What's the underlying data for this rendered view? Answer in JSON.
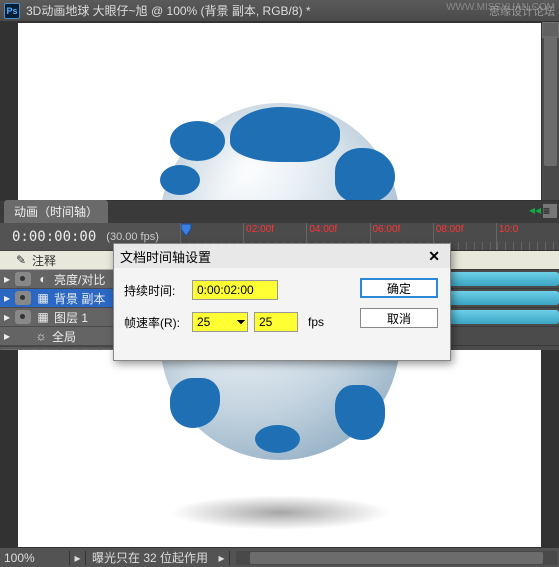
{
  "titlebar": {
    "app_icon_text": "Ps",
    "document_title": "3D动画地球    大眼仔~旭 @ 100% (背景 副本, RGB/8) *",
    "watermark_right": "思缘设计论坛",
    "watermark_corner": "WWW.MISSYUAN.COM"
  },
  "timeline": {
    "panel_tab": "动画（时间轴）",
    "current_time": "0:00:00:00",
    "fps_label": "(30.00 fps)",
    "ruler_ticks": [
      "",
      "02:00f",
      "04:00f",
      "06:00f",
      "08:00f",
      "10:0"
    ],
    "layers": {
      "comment": "注释",
      "brightness": "亮度/对比",
      "bgcopy": "背景 副本",
      "layer1": "图层 1",
      "global": "全局"
    }
  },
  "dialog": {
    "title": "文档时间轴设置",
    "duration_label": "持续时间:",
    "duration_value": "0:00:02:00",
    "framerate_label": "帧速率(R):",
    "framerate_select": "25",
    "framerate_value": "25",
    "fps_suffix": "fps",
    "ok": "确定",
    "cancel": "取消"
  },
  "statusbar": {
    "zoom": "100%",
    "message": "曝光只在 32 位起作用"
  }
}
